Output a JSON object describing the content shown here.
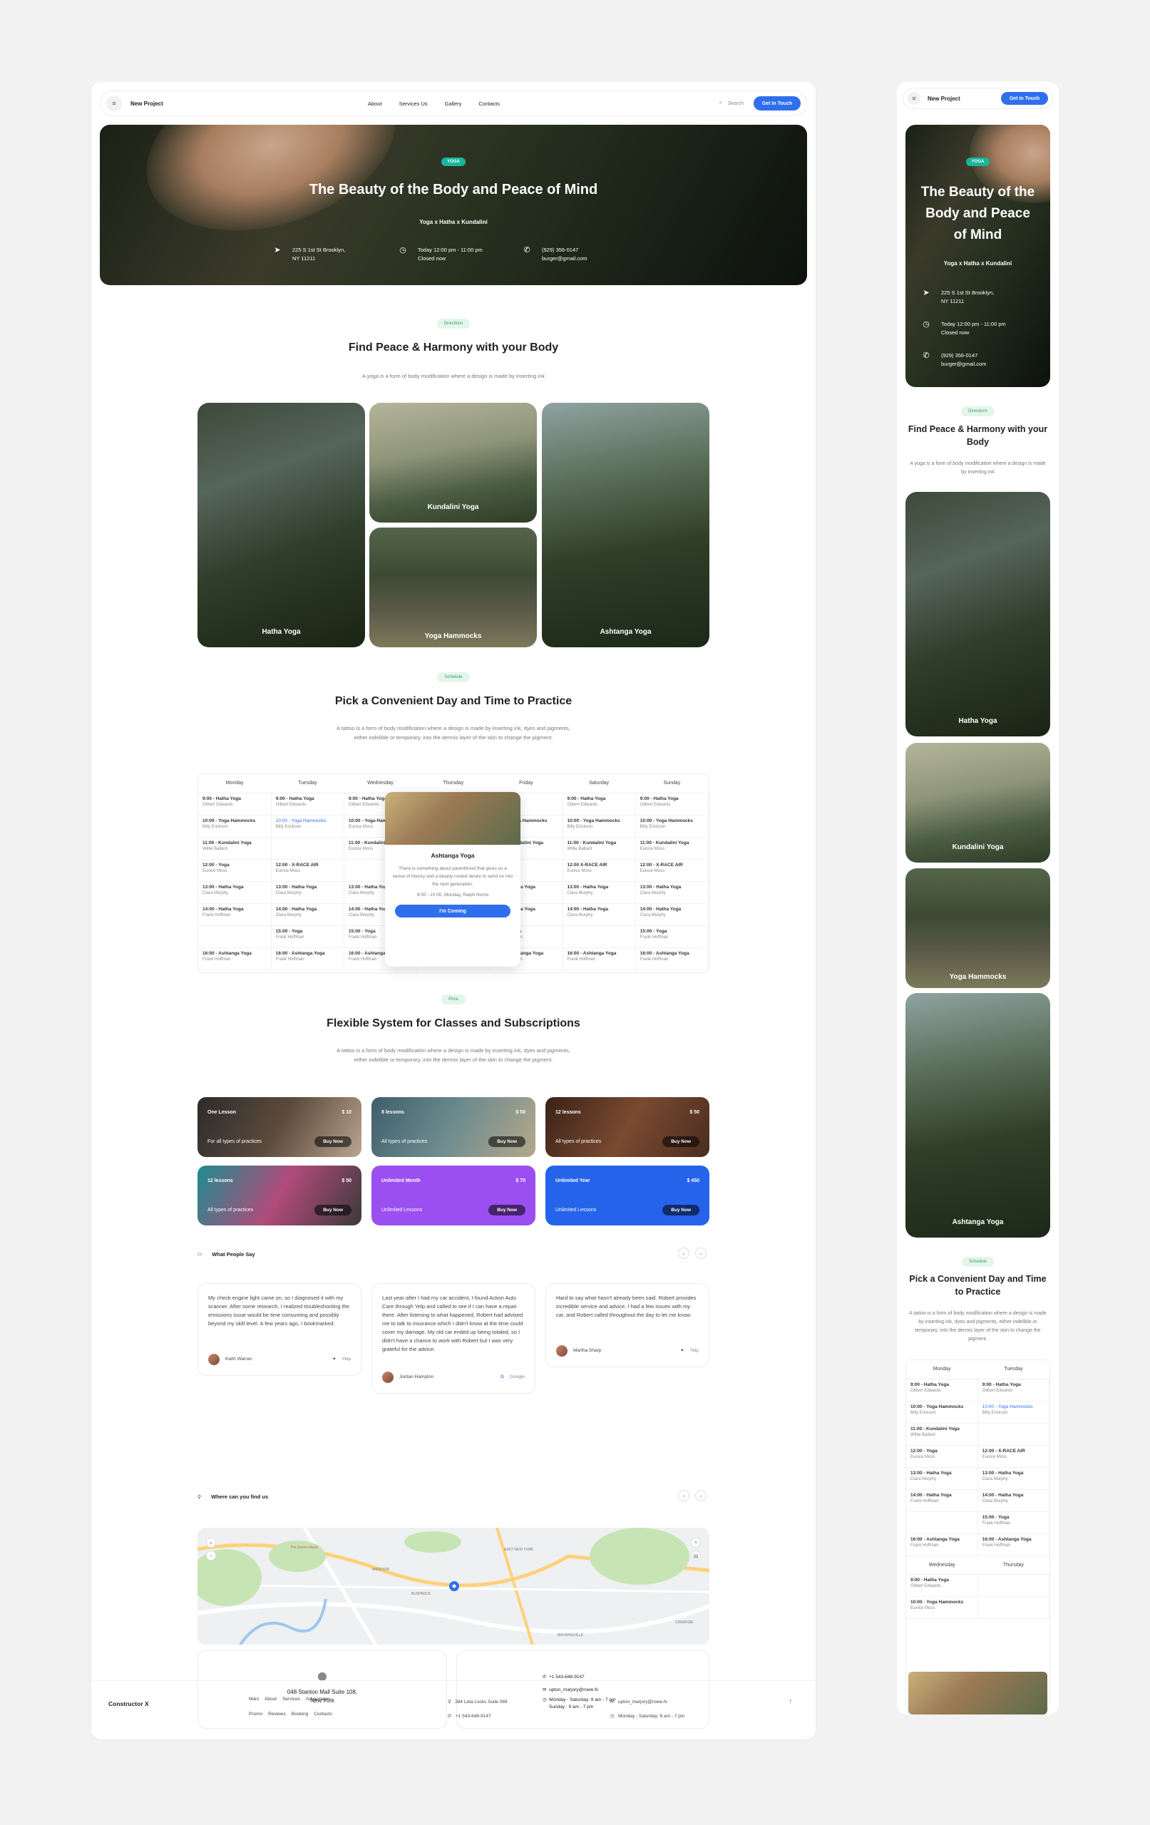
{
  "nav": {
    "brand": "New Project",
    "links": [
      "About",
      "Services Us",
      "Gallery",
      "Contacts"
    ],
    "search": "Search",
    "cta": "Get In Touch"
  },
  "hero": {
    "badge": "YOGA",
    "title": "The Beauty of the Body and Peace of Mind",
    "mobile_title": "The Beauty of the Body and Peace of Mind",
    "subtitle": "Yoga x Hatha x Kundalini",
    "address_1": "225 S 1st St Brooklyn,",
    "address_2": "NY 11211",
    "hours_1": "Today 12:00 pm - 11:00 pm",
    "hours_2": "Closed now",
    "phone": "(929) 356-0147",
    "email": "burger@gmail.com"
  },
  "directions": {
    "badge": "Directions",
    "title": "Find Peace & Harmony with your Body",
    "subtitle": "A yoga is a form of body modification where a design is made by inserting ink",
    "items": [
      "Hatha Yoga",
      "Kundalini Yoga",
      "Yoga Hammocks",
      "Ashtanga Yoga"
    ]
  },
  "schedule": {
    "badge": "Schedule",
    "title": "Pick a Convenient Day and Time to Practice",
    "subtitle": "A tattoo is a form of body modification where a design is made by inserting ink, dyes and pigments, either indelible or temporary, into the dermis layer of the skin to change the pigment.",
    "days": [
      "Monday",
      "Tuesday",
      "Wednesday",
      "Thursday",
      "Friday",
      "Saturday",
      "Sunday"
    ],
    "rows": [
      [
        [
          "9:00 - Hatha Yoga",
          "Gilbert Edwards"
        ],
        [
          "9:00 - Hatha Yoga",
          "Gilbert Edwards"
        ],
        [
          "9:00 - Hatha Yoga",
          "Gilbert Edwards"
        ],
        [
          "",
          ""
        ],
        [
          "",
          ""
        ],
        [
          "9:00 - Hatha Yoga",
          "Gilbert Edwards"
        ],
        [
          "9:00 - Hatha Yoga",
          "Gilbert Edwards"
        ]
      ],
      [
        [
          "10:00 - Yoga Hammocks",
          "Billy Erickson"
        ],
        [
          "10:00 - Yoga Hammocks",
          "Billy Erickson"
        ],
        [
          "10:00 - Yoga Hammocks",
          "Eunice Moss"
        ],
        [
          "",
          ""
        ],
        [
          "10:00 - Yoga Hammocks",
          "Eunice Moss"
        ],
        [
          "10:00 - Yoga Hammocks",
          "Billy Erickson"
        ],
        [
          "10:00 - Yoga Hammocks",
          "Billy Erickson"
        ]
      ],
      [
        [
          "11:00 - Kundalini Yoga",
          "Willie Ballard"
        ],
        [
          "",
          ""
        ],
        [
          "11:00 - Kundalini Yoga",
          "Eunice Moss"
        ],
        [
          "",
          ""
        ],
        [
          "11:00 - Kundalini Yoga",
          "Eunice Moss"
        ],
        [
          "11:00 - Kundalini Yoga",
          "Willie Ballard"
        ],
        [
          "11:00 - Kundalini Yoga",
          "Eunice Moss"
        ]
      ],
      [
        [
          "12:00 - Yoga",
          "Eunice Moss"
        ],
        [
          "12:00 - X-RACE AIR",
          "Eunice Moss"
        ],
        [
          "",
          ""
        ],
        [
          "",
          ""
        ],
        [
          "",
          ""
        ],
        [
          "12:00 X-RACE AIR",
          "Eunice Moss"
        ],
        [
          "12:00 - X-RACE AIR",
          "Eunice Moss"
        ]
      ],
      [
        [
          "13:00 - Hatha Yoga",
          "Clara Murphy"
        ],
        [
          "13:00 - Hatha Yoga",
          "Clara Murphy"
        ],
        [
          "13:00 - Hatha Yoga",
          "Clara Murphy"
        ],
        [
          "",
          ""
        ],
        [
          "13:00 - Hatha Yoga",
          "Clara Murphy"
        ],
        [
          "13:00 - Hatha Yoga",
          "Clara Murphy"
        ],
        [
          "13:00 - Hatha Yoga",
          "Clara Murphy"
        ]
      ],
      [
        [
          "14:00 - Hatha Yoga",
          "Frank Hoffman"
        ],
        [
          "14:00 - Hatha Yoga",
          "Clara Murphy"
        ],
        [
          "14:00 - Hatha Yoga",
          "Clara Murphy"
        ],
        [
          "",
          ""
        ],
        [
          "14:00 - Hatha Yoga",
          "Clara Murphy"
        ],
        [
          "14:00 - Hatha Yoga",
          "Clara Murphy"
        ],
        [
          "14:00 - Hatha Yoga",
          "Clara Murphy"
        ]
      ],
      [
        [
          "",
          ""
        ],
        [
          "15:00 - Yoga",
          "Frank Hoffman"
        ],
        [
          "15:00 - Yoga",
          "Frank Hoffman"
        ],
        [
          "",
          ""
        ],
        [
          "15:00 - Yoga",
          "Frank Hoffman"
        ],
        [
          "",
          ""
        ],
        [
          "15:00 - Yoga",
          "Frank Hoffman"
        ]
      ],
      [
        [
          "16:00 - Ashtanga Yoga",
          "Frank Hoffman"
        ],
        [
          "16:00 - Ashtanga Yoga",
          "Frank Hoffman"
        ],
        [
          "16:00 - Ashtanga Yoga",
          "Frank Hoffman"
        ],
        [
          "16:00 - Ashtanga Yoga",
          "Frank Hoffman"
        ],
        [
          "16:00 - Ashtanga Yoga",
          "Frank Hoffman"
        ],
        [
          "16:00 - Ashtanga Yoga",
          "Frank Hoffman"
        ],
        [
          "16:00 - Ashtanga Yoga",
          "Frank Hoffman"
        ]
      ]
    ],
    "popup": {
      "title": "Ashtanga Yoga",
      "text": "There is something about parenthood that gives us a sense of history and a deeply rooted desire to send on into the next generation.",
      "meta": "9:00 - 10:00, Monday, Ralph Norris",
      "cta": "I'm Coming"
    }
  },
  "pricing": {
    "badge": "Price",
    "title": "Flexible System for Classes and Subscriptions",
    "subtitle": "A tattoo is a form of body modification where a design is made by inserting ink, dyes and pigments, either indelible or temporary, into the dermis layer of the skin to change the pigment.",
    "plans": [
      {
        "name": "One Lesson",
        "price": "$ 10",
        "desc": "For all types of practices",
        "cta": "Buy Now"
      },
      {
        "name": "8 lessons",
        "price": "$ 50",
        "desc": "All types of practices",
        "cta": "Buy Now"
      },
      {
        "name": "12 lessons",
        "price": "$ 50",
        "desc": "All types of practices",
        "cta": "Buy Now"
      },
      {
        "name": "12 lessons",
        "price": "$ 50",
        "desc": "All types of practices",
        "cta": "Buy Now"
      },
      {
        "name": "Unlimited Month",
        "price": "$ 70",
        "desc": "Unlimited Lessons",
        "cta": "Buy Now"
      },
      {
        "name": "Unlimited Year",
        "price": "$ 450",
        "desc": "Unlimited Lessons",
        "cta": "Buy Now"
      }
    ]
  },
  "reviews": {
    "title": "What People Say",
    "items": [
      {
        "text": "My check engine light came on, so I diagnosed it with my scanner. After some research, I realized troubleshooting the emissions issue would be time consuming and possibly beyond my skill level. A few years ago, I bookmarked.",
        "name": "Keith Warren",
        "source": "Yelp"
      },
      {
        "text": "Last year after I had my car accident, I found Action Auto Care through Yelp and called to see if I can have a repair there. After listening to what happened, Robert had advised me to talk to insurance which I didn't know at the time could cover my damage. My old car ended up being totaled, so I didn't have a chance to work with Robert but I was very grateful for the advice.",
        "name": "Jordan Hampton",
        "source": "Google"
      },
      {
        "text": "Hard to say what hasn't already been said. Robert provides incredible service and advice. I had a few issues with my car, and Robert called throughout the day to let me know.",
        "name": "Martha Sharp",
        "source": "Yelp"
      }
    ]
  },
  "location": {
    "title": "Where can you find us",
    "address_1": "048 Stanton Mall Suite 108,",
    "address_2": "New York",
    "phone": "+1 543-648-9147",
    "email": "upton_marjory@rowe.fv",
    "hours_1": "Monday - Saturday: 8 am - 7 pm",
    "hours_2": "Sunday : 9 am - 7 pm",
    "map_labels": [
      "EAST NEW YORK",
      "BUSHWICK",
      "WINDSOR",
      "BROWNSVILLE",
      "CANARSIE",
      "The Green Island"
    ]
  },
  "footer": {
    "brand": "Constructor X",
    "links_1": [
      "Main",
      "About",
      "Services",
      "Advantages"
    ],
    "links_2": [
      "Promo",
      "Reviews",
      "Booking",
      "Contacts"
    ],
    "address": "284 Leta Locks Suite 069",
    "phone": "+1 543-648-9147",
    "email": "upton_marjory@rowe.fv",
    "hours": "Monday - Saturday: 8 am - 7 pm"
  },
  "colors": {
    "accent": "#2f6fed",
    "teal": "#18b59a",
    "purple": "#9b4ff0",
    "blue": "#2563eb"
  }
}
